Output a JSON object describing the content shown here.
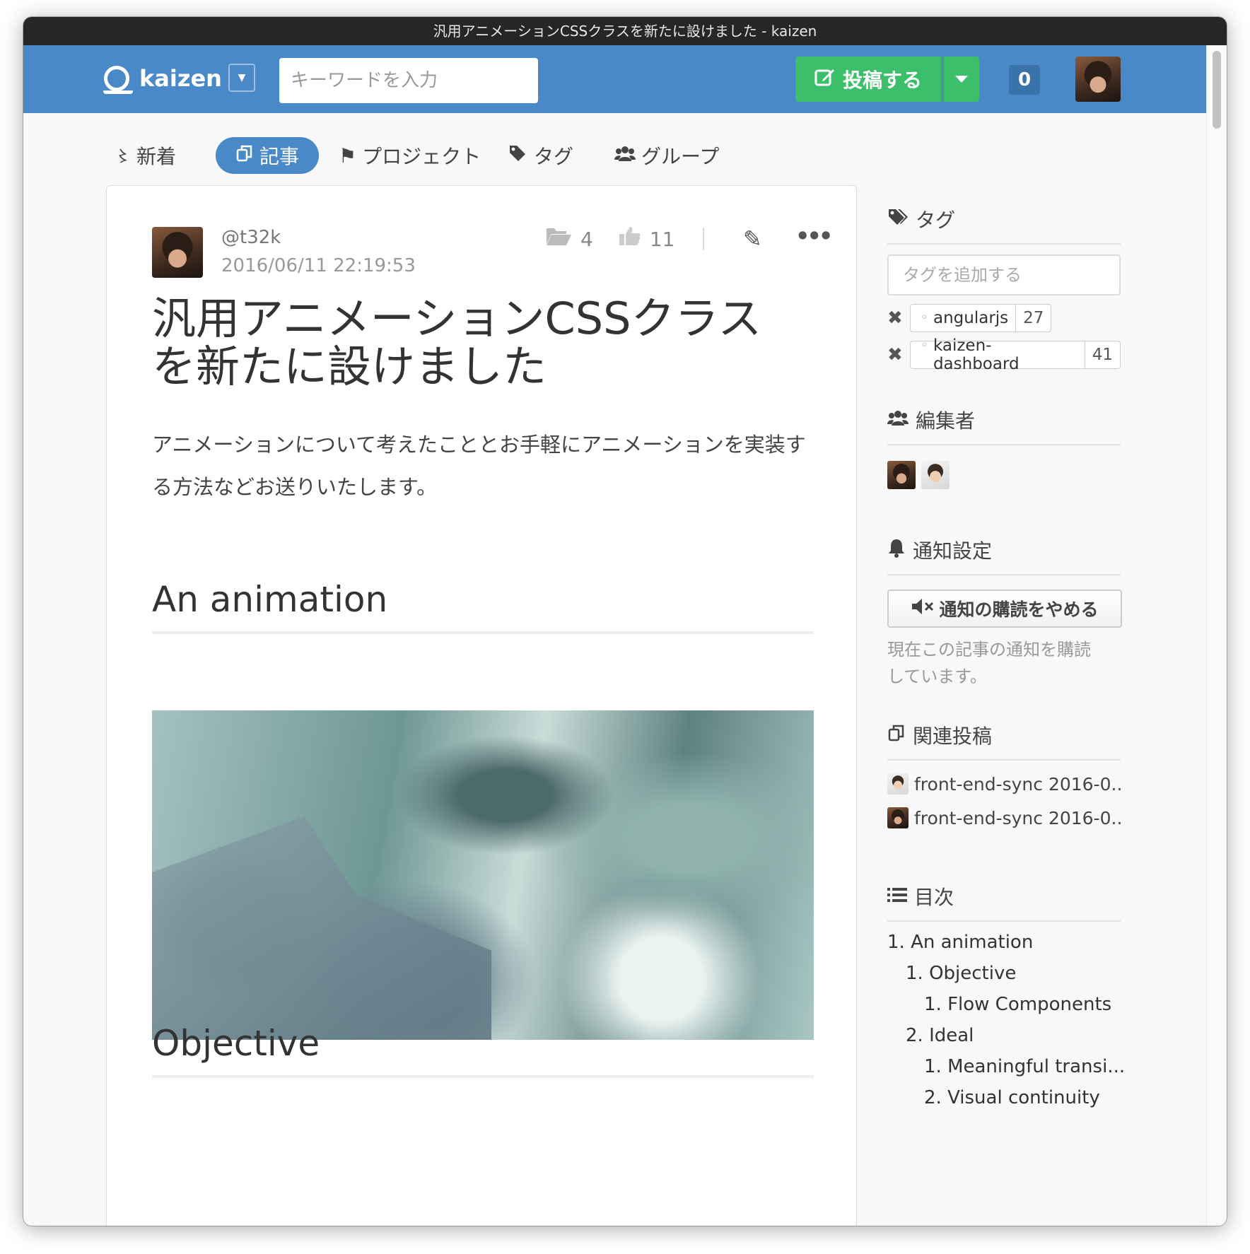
{
  "window": {
    "title": "汎用アニメーションCSSクラスを新たに設けました - kaizen"
  },
  "header": {
    "logo_text": "kaizen",
    "search_placeholder": "キーワードを入力",
    "post_button_label": "投稿する",
    "notification_count": "0"
  },
  "tabs": [
    {
      "label": "新着",
      "icon": "rss-icon"
    },
    {
      "label": "記事",
      "icon": "documents-icon",
      "active": true
    },
    {
      "label": "プロジェクト",
      "icon": "flag-icon"
    },
    {
      "label": "タグ",
      "icon": "tags-icon"
    },
    {
      "label": "グループ",
      "icon": "users-icon"
    }
  ],
  "article": {
    "author": "@t32k",
    "date": "2016/06/11 22:19:53",
    "folder_count": "4",
    "like_count": "11",
    "title": "汎用アニメーションCSSクラスを新たに設けました",
    "lead": "アニメーションについて考えたこととお手軽にアニメーションを実装する方法などお送りいたします。",
    "heading1": "An animation",
    "heading2": "Objective"
  },
  "sidebar": {
    "tags": {
      "heading": "タグ",
      "input_placeholder": "タグを追加する",
      "items": [
        {
          "name": "angularjs",
          "count": "27"
        },
        {
          "name": "kaizen-dashboard",
          "count": "41"
        }
      ]
    },
    "editors": {
      "heading": "編集者"
    },
    "notification": {
      "heading": "通知設定",
      "button_label": "通知の購読をやめる",
      "note": "現在この記事の通知を購読しています。"
    },
    "related": {
      "heading": "関連投稿",
      "items": [
        {
          "title": "front-end-sync 2016-0..."
        },
        {
          "title": "front-end-sync 2016-0..."
        }
      ]
    },
    "toc": {
      "heading": "目次",
      "items": [
        {
          "label": "1. An animation",
          "level": 0
        },
        {
          "label": "1. Objective",
          "level": 1
        },
        {
          "label": "1. Flow Components",
          "level": 2
        },
        {
          "label": "2. Ideal",
          "level": 1
        },
        {
          "label": "1. Meaningful transi...",
          "level": 2
        },
        {
          "label": "2. Visual continuity",
          "level": 2
        }
      ]
    }
  },
  "colors": {
    "brand": "#4a89c8",
    "post_button": "#3cbf6b"
  }
}
